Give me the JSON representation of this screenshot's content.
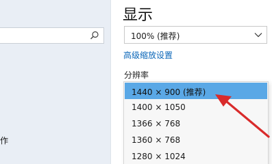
{
  "sidebar": {
    "partial_item_label": "作"
  },
  "main": {
    "title": "显示",
    "scale": {
      "selected": "100% (推荐)"
    },
    "advanced_link": "高级缩放设置",
    "resolution": {
      "label": "分辨率",
      "options": [
        {
          "label": "1440 × 900 (推荐)",
          "selected": true
        },
        {
          "label": "1400 × 1050",
          "selected": false
        },
        {
          "label": "1366 × 768",
          "selected": false
        },
        {
          "label": "1360 × 768",
          "selected": false
        },
        {
          "label": "1280 × 1024",
          "selected": false
        }
      ]
    }
  },
  "annotation": {
    "arrow_color": "#d92b2b"
  },
  "colors": {
    "sidebar_bg": "#e9eef5",
    "selection": "#5aa8e6",
    "link": "#0a66b8"
  }
}
